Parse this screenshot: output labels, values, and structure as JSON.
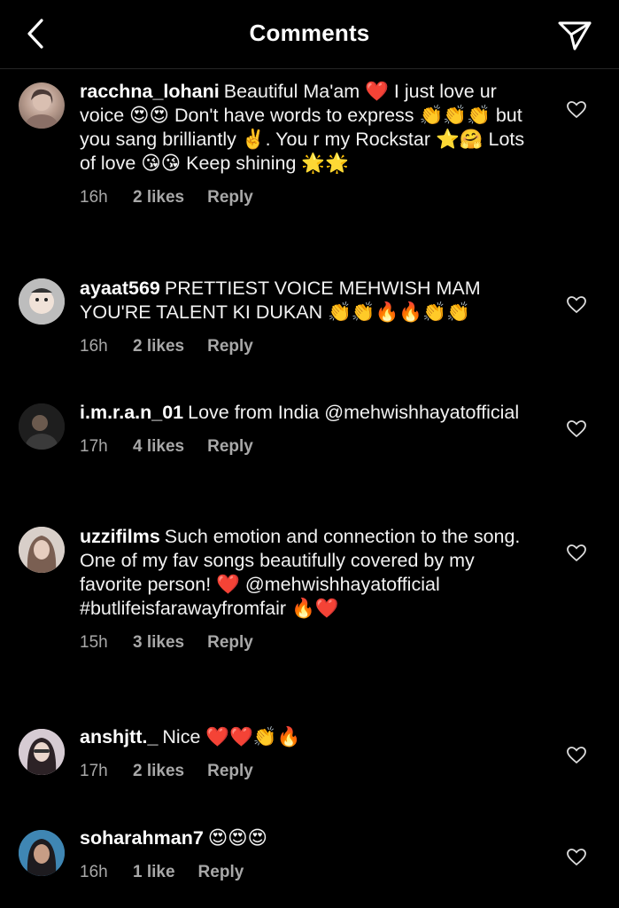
{
  "header": {
    "title": "Comments",
    "back_icon": "chevron-left-icon",
    "send_icon": "paper-plane-icon"
  },
  "colors": {
    "background": "#000000",
    "text": "#f2f2f2",
    "meta": "#a8a8a8",
    "heart_red": "#ed4956"
  },
  "comments": [
    {
      "username": "racchna_lohani",
      "text": "Beautiful Ma'am ❤️ I just love ur voice 😍😍 Don't have words to express 👏👏👏 but you sang brilliantly ✌️. You r my Rockstar ⭐🤗 Lots of love 😘😘 Keep shining 🌟🌟",
      "time": "16h",
      "likes": "2 likes",
      "reply": "Reply"
    },
    {
      "username": "ayaat569",
      "text": "PRETTIEST VOICE MEHWISH MAM YOU'RE TALENT KI DUKAN 👏👏🔥🔥👏👏",
      "time": "16h",
      "likes": "2 likes",
      "reply": "Reply"
    },
    {
      "username": "i.m.r.a.n_01",
      "text": "Love from India @mehwishhayatofficial",
      "time": "17h",
      "likes": "4 likes",
      "reply": "Reply"
    },
    {
      "username": "uzzifilms",
      "text": "Such emotion and connection to the song. One of my fav songs beautifully covered by my favorite person! ❤️ @mehwishhayatofficial #butlifeisfarawayfromfair 🔥❤️",
      "time": "15h",
      "likes": "3 likes",
      "reply": "Reply"
    },
    {
      "username": "anshjtt._",
      "text": "Nice ❤️❤️👏🔥",
      "time": "17h",
      "likes": "2 likes",
      "reply": "Reply"
    },
    {
      "username": "soharahman7",
      "text": "😍😍😍",
      "time": "16h",
      "likes": "1 like",
      "reply": "Reply"
    }
  ]
}
